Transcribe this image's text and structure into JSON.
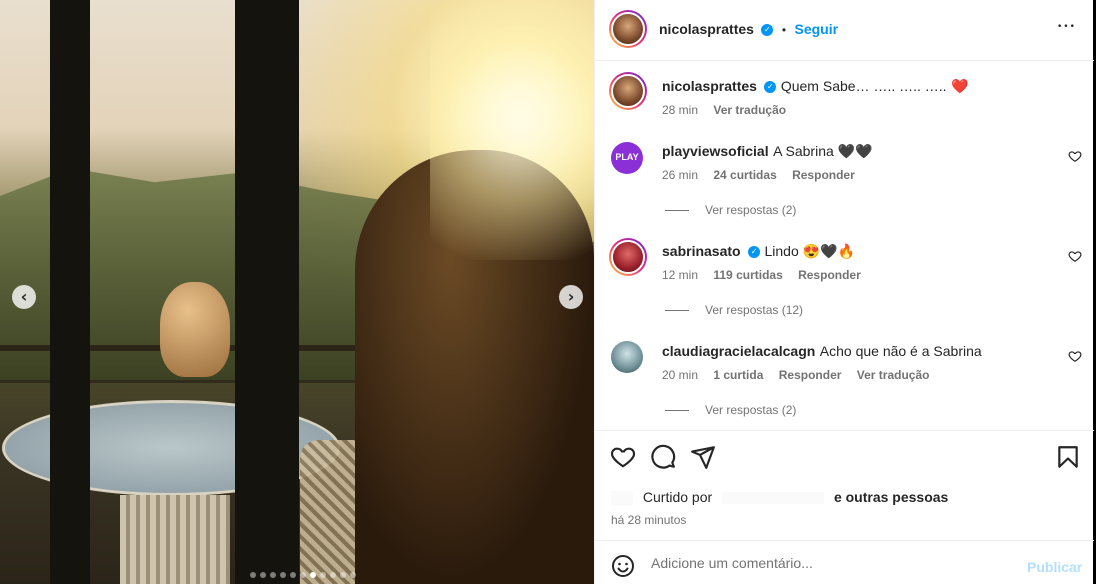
{
  "post": {
    "author": "nicolasprattes",
    "verified_mark": "✓",
    "separator": "•",
    "follow_label": "Seguir",
    "more_icon": "more-horizontal-icon",
    "more_glyph": "•••",
    "caption": {
      "text": "Quem Sabe… ….. ….. …..",
      "emoji": "❤️",
      "time": "28 min",
      "translate_label": "Ver tradução"
    },
    "carousel": {
      "slide_count": 11,
      "active_index": 6,
      "prev_glyph": "‹",
      "next_glyph": "›"
    }
  },
  "comments": [
    {
      "username": "playviewsoficial",
      "avatar_text": "PLAY",
      "text": "A Sabrina 🖤🖤",
      "time": "26 min",
      "likes": "24 curtidas",
      "reply_label": "Responder",
      "view_replies": "Ver respostas (2)"
    },
    {
      "username": "sabrinasato",
      "verified_mark": "✓",
      "text": "Lindo 😍🖤🔥",
      "time": "12 min",
      "likes": "119 curtidas",
      "reply_label": "Responder",
      "view_replies": "Ver respostas (12)"
    },
    {
      "username": "claudiagracielacalcagn",
      "text": "Acho que não é a Sabrina",
      "time": "20 min",
      "likes": "1 curtida",
      "reply_label": "Responder",
      "translate_label": "Ver tradução",
      "view_replies": "Ver respostas (2)"
    }
  ],
  "actions": {
    "like_icon": "heart-icon",
    "comment_icon": "comment-icon",
    "share_icon": "send-icon",
    "save_icon": "bookmark-icon"
  },
  "likes_summary": {
    "prefix": "Curtido por",
    "suffix": "e outras pessoas",
    "time_ago": "há 28 minutos"
  },
  "comment_box": {
    "placeholder": "Adicione um comentário...",
    "publish_label": "Publicar",
    "emoji_icon": "smiley-icon"
  },
  "colors": {
    "accent": "#0095f6",
    "publish_disabled": "#b2dffc",
    "heart_red": "#ed4956"
  }
}
